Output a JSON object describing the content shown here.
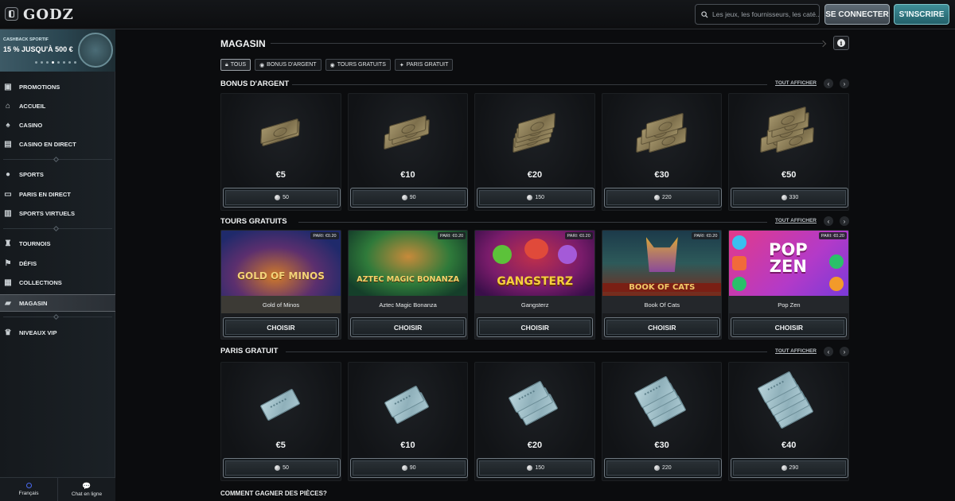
{
  "header": {
    "logo": "GODZ",
    "search_placeholder": "Les jeux, les fournisseurs, les caté...",
    "login_label": "SE CONNECTER",
    "register_label": "S'INSCRIRE"
  },
  "sidebar": {
    "promo": {
      "small": "CASHBACK SPORTIF",
      "big": "15 % JUSQU'À 500 €",
      "slides": 8,
      "active_slide": 3
    },
    "items": [
      {
        "label": "PROMOTIONS",
        "icon": "gift-icon"
      },
      {
        "label": "ACCUEIL",
        "icon": "home-icon"
      },
      {
        "label": "CASINO",
        "icon": "cards-icon"
      },
      {
        "label": "CASINO EN DIRECT",
        "icon": "live-casino-icon"
      },
      {
        "label": "SPORTS",
        "icon": "ball-icon"
      },
      {
        "label": "PARIS EN DIRECT",
        "icon": "live-bet-icon"
      },
      {
        "label": "SPORTS VIRTUELS",
        "icon": "virtual-sports-icon"
      },
      {
        "label": "TOURNOIS",
        "icon": "tournament-icon"
      },
      {
        "label": "DÉFIS",
        "icon": "challenge-icon"
      },
      {
        "label": "COLLECTIONS",
        "icon": "collections-icon"
      },
      {
        "label": "MAGASIN",
        "icon": "shop-icon"
      },
      {
        "label": "NIVEAUX VIP",
        "icon": "vip-icon"
      }
    ],
    "language_label": "Français",
    "chat_label": "Chat en ligne"
  },
  "main": {
    "title": "MAGASIN",
    "filters": [
      {
        "label": "TOUS",
        "icon": "lock-icon",
        "active": true
      },
      {
        "label": "BONUS D'ARGENT",
        "icon": "coin-icon",
        "active": false
      },
      {
        "label": "TOURS GRATUITS",
        "icon": "coin-icon",
        "active": false
      },
      {
        "label": "PARIS GRATUIT",
        "icon": "star-icon",
        "active": false
      }
    ],
    "show_all": "TOUT AFFICHER",
    "money_section": {
      "title": "BONUS D'ARGENT",
      "cards": [
        {
          "price": "€5",
          "cost": "50"
        },
        {
          "price": "€10",
          "cost": "90"
        },
        {
          "price": "€20",
          "cost": "150"
        },
        {
          "price": "€30",
          "cost": "220"
        },
        {
          "price": "€50",
          "cost": "330"
        }
      ]
    },
    "spins_section": {
      "title": "TOURS GRATUITS",
      "choose_label": "CHOISIR",
      "games": [
        {
          "name": "Gold of Minos",
          "bet": "PARI: €0.20",
          "art_text": "GOLD OF MINOS"
        },
        {
          "name": "Aztec Magic Bonanza",
          "bet": "PARI: €0.20",
          "art_text": "AZTEC MAGIC BONANZA"
        },
        {
          "name": "Gangsterz",
          "bet": "PARI: €0.20",
          "art_text": "GANGSTERZ"
        },
        {
          "name": "Book Of Cats",
          "bet": "PARI: €0.20",
          "art_text": "BOOK OF CATS"
        },
        {
          "name": "Pop Zen",
          "bet": "PARI: €0.20",
          "art_text": "POP ZEN"
        }
      ]
    },
    "bets_section": {
      "title": "PARIS GRATUIT",
      "cards": [
        {
          "price": "€5",
          "cost": "50"
        },
        {
          "price": "€10",
          "cost": "90"
        },
        {
          "price": "€20",
          "cost": "150"
        },
        {
          "price": "€30",
          "cost": "220"
        },
        {
          "price": "€40",
          "cost": "290"
        }
      ]
    },
    "footer_question": "COMMENT GAGNER DES PIÈCES?"
  }
}
